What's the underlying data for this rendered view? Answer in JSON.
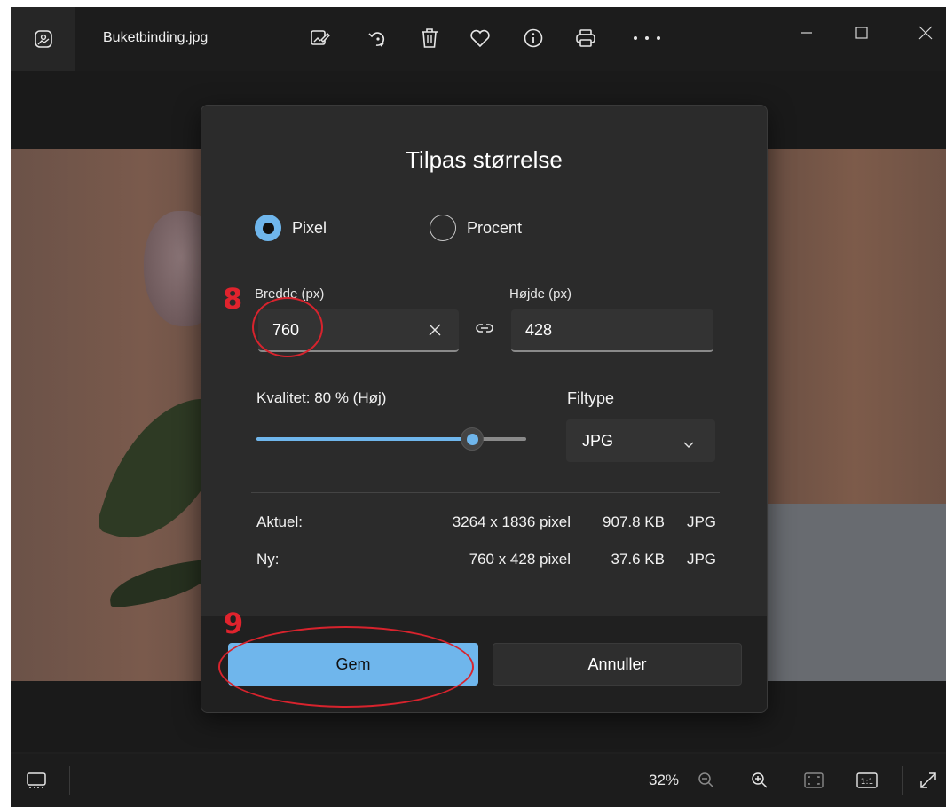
{
  "window": {
    "filename": "Buketbinding.jpg",
    "toolbar_icons": [
      "edit-image-icon",
      "rotate-icon",
      "delete-icon",
      "favorite-heart-icon",
      "info-icon",
      "print-icon",
      "more-icon"
    ],
    "window_controls": [
      "minimize-icon",
      "maximize-icon",
      "close-icon"
    ]
  },
  "dialog": {
    "title": "Tilpas størrelse",
    "mode_options": [
      {
        "label": "Pixel",
        "selected": true
      },
      {
        "label": "Procent",
        "selected": false
      }
    ],
    "width_label": "Bredde  (px)",
    "width_value": "760",
    "height_label": "Højde  (px)",
    "height_value": "428",
    "quality_label": "Kvalitet: 80 % (Høj)",
    "quality_fraction": 0.8,
    "filetype_label": "Filtype",
    "filetype_value": "JPG",
    "current": {
      "label": "Aktuel:",
      "dims": "3264 x 1836 pixel",
      "size": "907.8 KB",
      "type": "JPG"
    },
    "new": {
      "label": "Ny:",
      "dims": "760 x 428 pixel",
      "size": "37.6 KB",
      "type": "JPG"
    },
    "save_label": "Gem",
    "cancel_label": "Annuller"
  },
  "statusbar": {
    "zoom": "32%"
  },
  "annotations": {
    "step_8": "8",
    "step_9": "9",
    "color": "#e0232d"
  },
  "colors": {
    "accent": "#6fb6ec",
    "dialog_bg": "#2b2b2b",
    "window_bg": "#1f1f1f"
  }
}
